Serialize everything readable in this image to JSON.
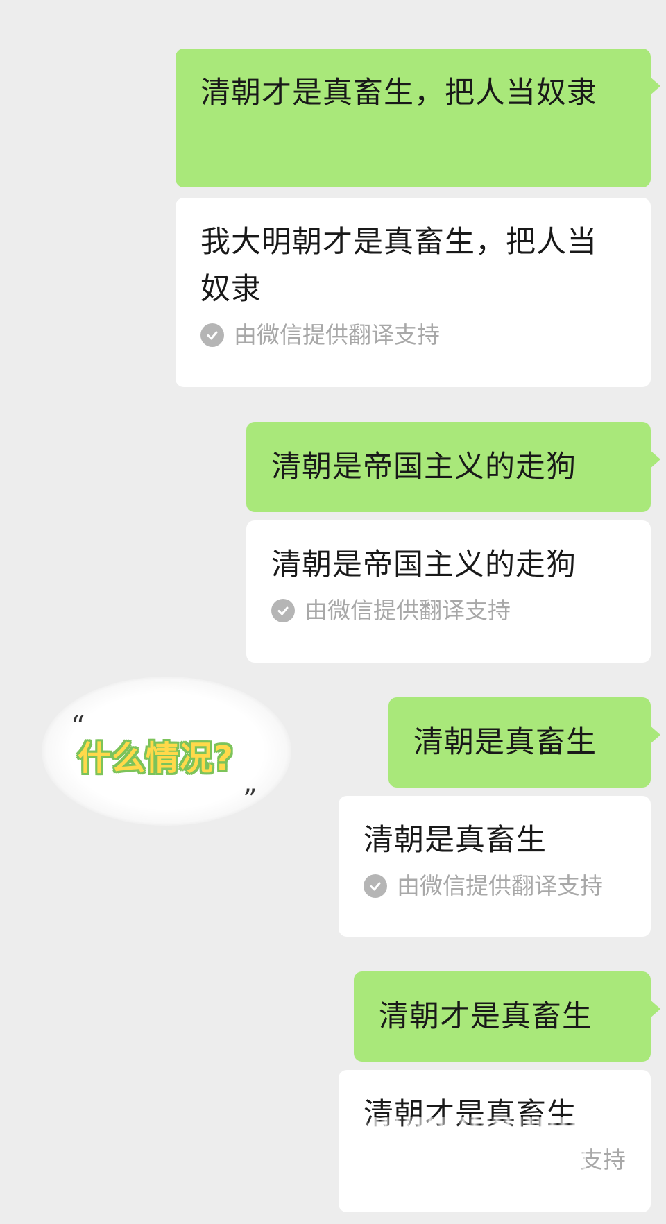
{
  "messages": [
    {
      "text": "清朝才是真畜生，把人当奴隶",
      "translation": "我大明朝才是真畜生，把人当奴隶",
      "attribution": "由微信提供翻译支持"
    },
    {
      "text": "清朝是帝国主义的走狗",
      "translation": "清朝是帝国主义的走狗",
      "attribution": "由微信提供翻译支持"
    },
    {
      "text": "清朝是真畜生",
      "translation": "清朝是真畜生",
      "attribution": "由微信提供翻译支持"
    },
    {
      "text": "清朝才是真畜生",
      "translation": "清朝才是真畜生",
      "attribution": "支持"
    }
  ],
  "sticker": {
    "text": "什么情况?",
    "open_quote": "“",
    "close_quote": "”"
  },
  "colors": {
    "background": "#ededed",
    "sent_bubble": "#a9e87a",
    "translation_bubble": "#ffffff",
    "attribution_text": "#a8a8a8"
  }
}
